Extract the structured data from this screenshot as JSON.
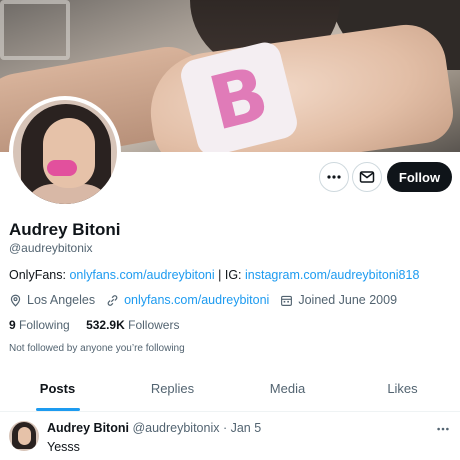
{
  "profile": {
    "name": "Audrey Bitoni",
    "handle": "@audreybitonix",
    "bio": {
      "prefix": "OnlyFans: ",
      "link1": "onlyfans.com/audreybitoni",
      "separator": " | IG: ",
      "link2": "instagram.com/audreybitoni818"
    },
    "location": "Los Angeles",
    "website": "onlyfans.com/audreybitoni",
    "joined": "Joined June 2009",
    "following_count": "9",
    "following_label": "Following",
    "followers_count": "532.9K",
    "followers_label": "Followers",
    "not_followed": "Not followed by anyone you’re following"
  },
  "banner": {
    "sticker_letter": "B"
  },
  "actions": {
    "follow_label": "Follow"
  },
  "tabs": [
    {
      "label": "Posts",
      "active": true
    },
    {
      "label": "Replies"
    },
    {
      "label": "Media"
    },
    {
      "label": "Likes"
    }
  ],
  "tweet": {
    "name": "Audrey Bitoni",
    "handle": "@audreybitonix",
    "dot": " · ",
    "date": "Jan 5",
    "text": "Yesss"
  },
  "icons": {
    "more": "more-horizontal-icon",
    "message": "envelope-icon",
    "location": "location-pin-icon",
    "link": "link-icon",
    "calendar": "calendar-icon"
  },
  "colors": {
    "accent": "#1d9bf0",
    "text": "#0f1419",
    "muted": "#536471",
    "follow_bg": "#0f1419",
    "sticker": "#e07bb8"
  }
}
